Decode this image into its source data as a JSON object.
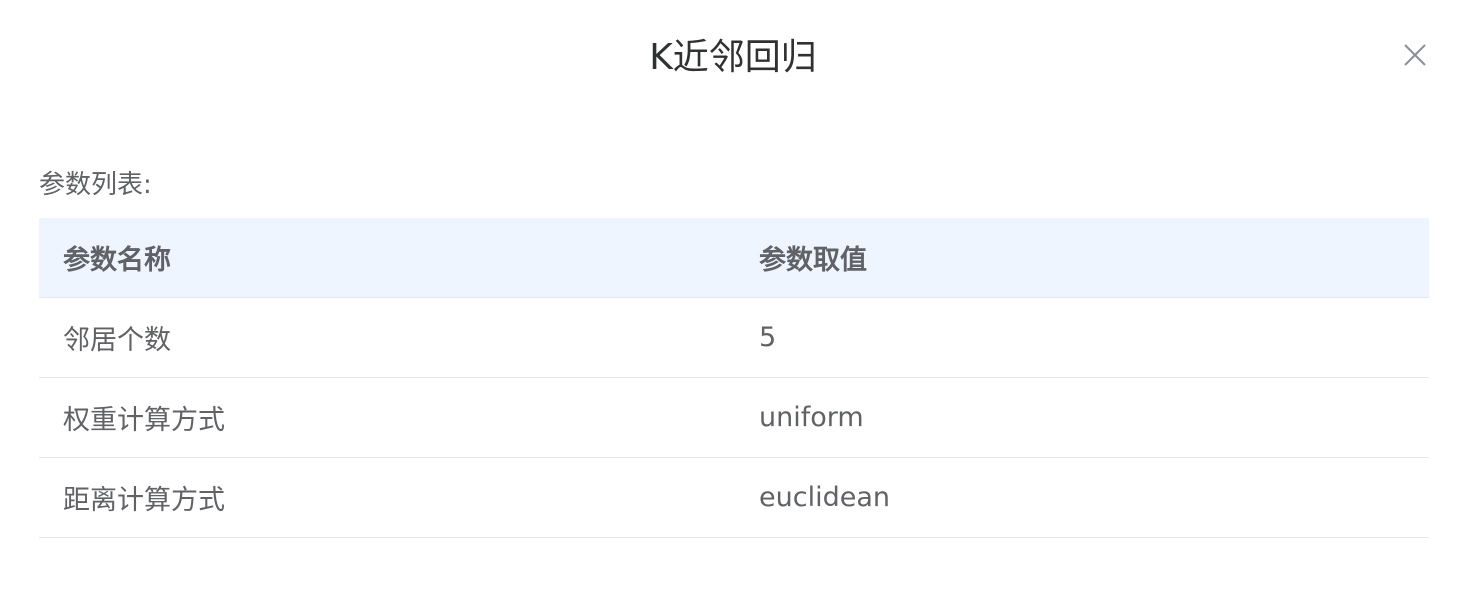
{
  "dialog": {
    "title": "K近邻回归",
    "close_icon": "close-icon"
  },
  "section_label": "参数列表:",
  "table": {
    "headers": [
      "参数名称",
      "参数取值"
    ],
    "rows": [
      {
        "name": "邻居个数",
        "value": "5"
      },
      {
        "name": "权重计算方式",
        "value": "uniform"
      },
      {
        "name": "距离计算方式",
        "value": "euclidean"
      }
    ]
  },
  "colors": {
    "header_bg": "#eef5fe",
    "border": "#e4e7ed",
    "text": "#606266"
  }
}
